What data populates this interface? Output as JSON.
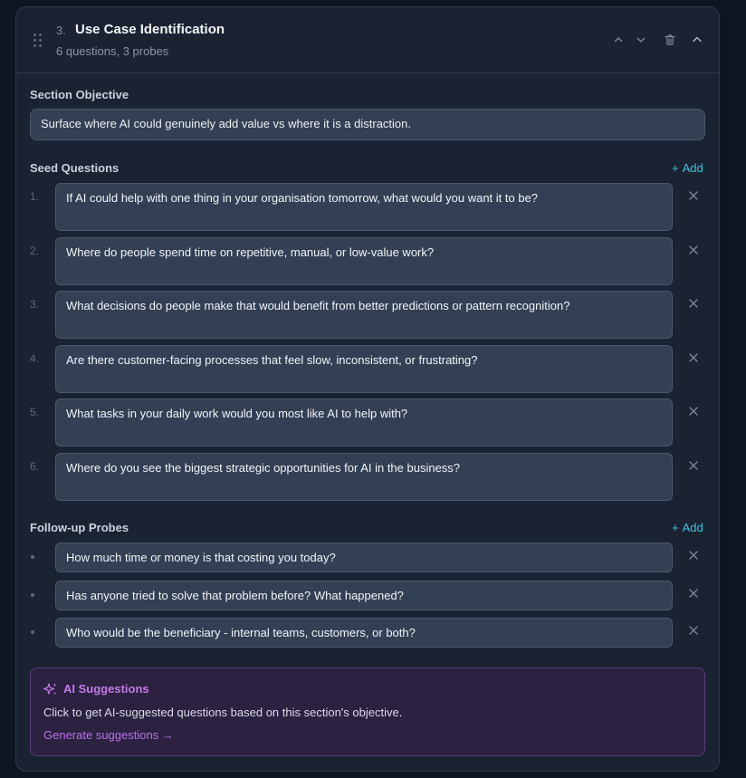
{
  "section": {
    "number": "3.",
    "title": "Use Case Identification",
    "meta": "6 questions, 3 probes"
  },
  "objective": {
    "label": "Section Objective",
    "value": "Surface where AI could genuinely add value vs where it is a distraction."
  },
  "seed": {
    "label": "Seed Questions",
    "add_label": "Add",
    "items": [
      {
        "num": "1.",
        "text": "If AI could help with one thing in your organisation tomorrow, what would you want it to be?"
      },
      {
        "num": "2.",
        "text": "Where do people spend time on repetitive, manual, or low-value work?"
      },
      {
        "num": "3.",
        "text": "What decisions do people make that would benefit from better predictions or pattern recognition?"
      },
      {
        "num": "4.",
        "text": "Are there customer-facing processes that feel slow, inconsistent, or frustrating?"
      },
      {
        "num": "5.",
        "text": "What tasks in your daily work would you most like AI to help with?"
      },
      {
        "num": "6.",
        "text": "Where do you see the biggest strategic opportunities for AI in the business?"
      }
    ]
  },
  "probes": {
    "label": "Follow-up Probes",
    "add_label": "Add",
    "items": [
      {
        "text": "How much time or money is that costing you today?"
      },
      {
        "text": "Has anyone tried to solve that problem before? What happened?"
      },
      {
        "text": "Who would be the beneficiary - internal teams, customers, or both?"
      }
    ]
  },
  "ai": {
    "title": "AI Suggestions",
    "description": "Click to get AI-suggested questions based on this section's objective.",
    "link": "Generate suggestions →"
  },
  "colors": {
    "accent": "#38c6e0",
    "ai_purple": "#c27ae8"
  }
}
